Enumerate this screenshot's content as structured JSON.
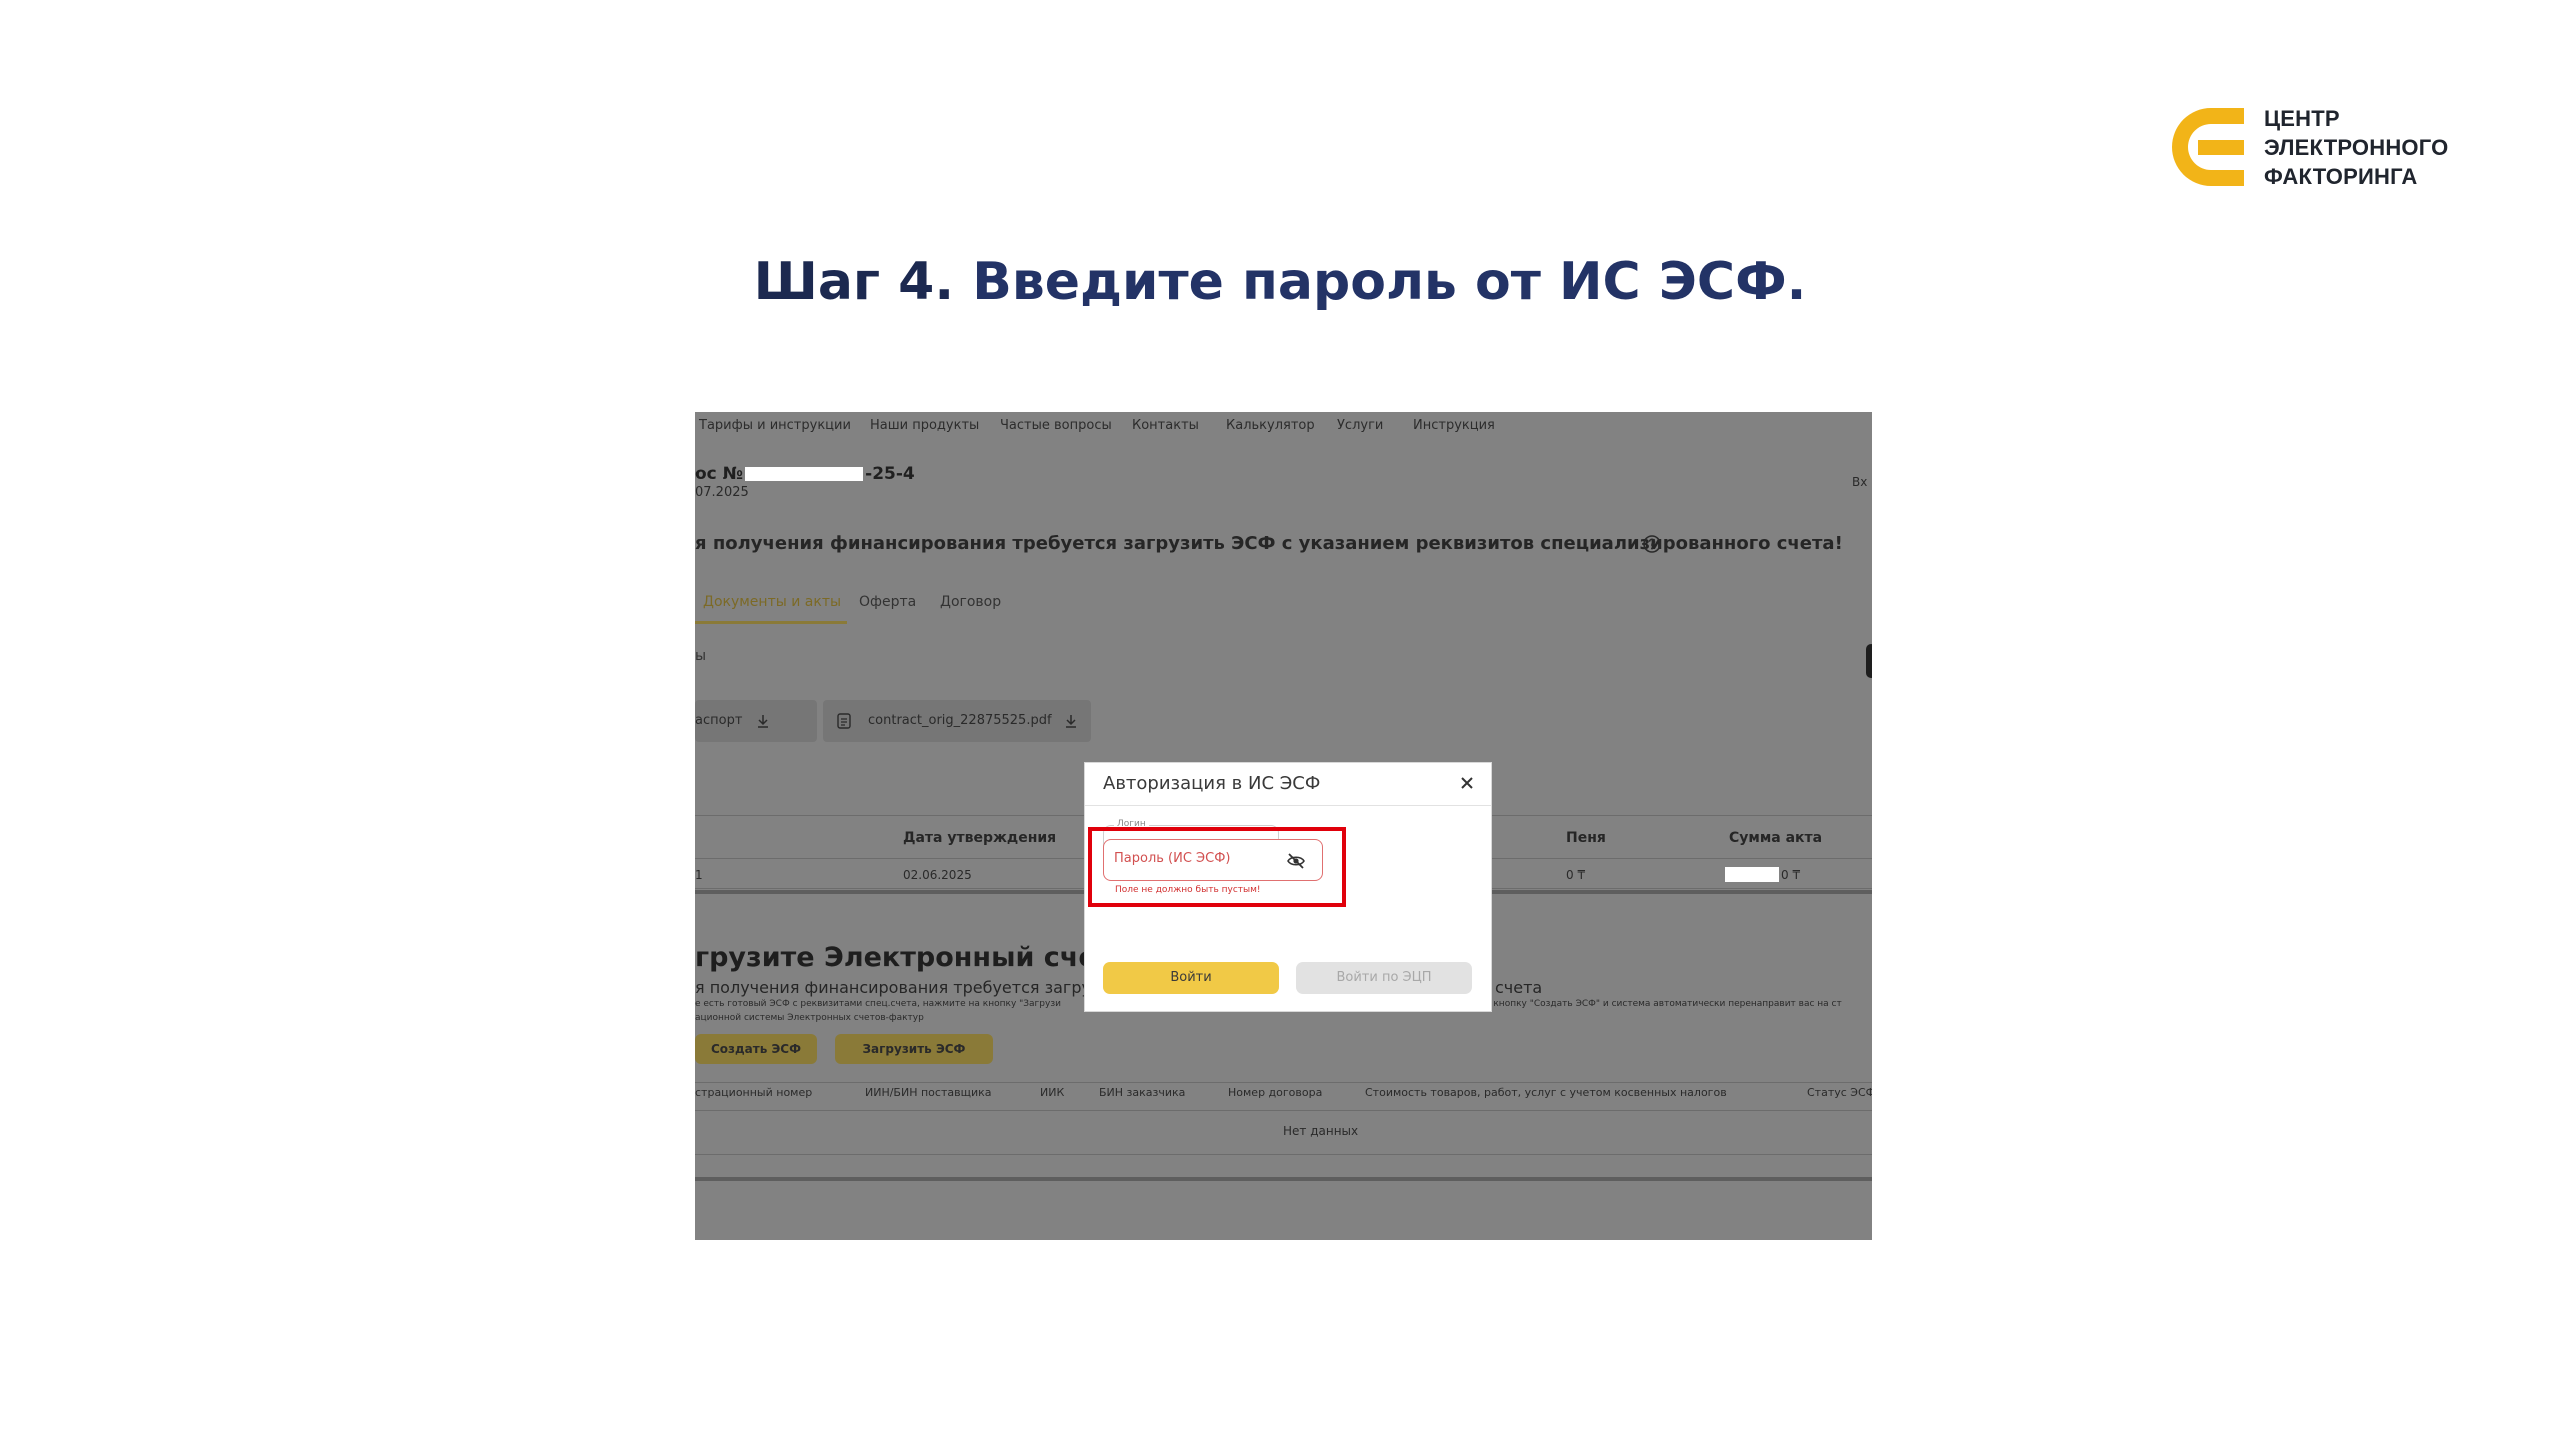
{
  "logo": {
    "lines": [
      "ЦЕНТР",
      "ЭЛЕКТРОННОГО",
      "ФАКТОРИНГА"
    ],
    "colors": {
      "accent": "#f2b418",
      "text": "#20252e"
    }
  },
  "slide_title": {
    "step": "Шаг 4.",
    "text": " Введите пароль от ИС ЭСФ."
  },
  "nav": [
    "Тарифы и инструкции",
    "Наши продукты",
    "Частые вопросы",
    "Контакты",
    "Калькулятор",
    "Услуги",
    "Инструкция"
  ],
  "deal": {
    "number_prefix": "ос №",
    "number_suffix": "-25-4",
    "date": "07.2025",
    "top_right": "Вх"
  },
  "notice": "я получения финансирования требуется загрузить ЭСФ с указанием реквизитов специализированного счета!",
  "tabs": [
    "Документы и акты",
    "Оферта",
    "Договор"
  ],
  "section_stub": "ы",
  "files": [
    {
      "label": "аспорт"
    },
    {
      "label": "contract_orig_22875525.pdf"
    }
  ],
  "acts_table": {
    "headers": [
      "Дата утверждения",
      "Пеня",
      "Сумма акта"
    ],
    "row": {
      "first": "1",
      "date": "02.06.2025",
      "penalty": "0 ₸",
      "amount_suffix": "0 ₸"
    }
  },
  "esf": {
    "heading": "грузите Электронный счет-факту",
    "subtext_left": "я получения финансирования требуется загрузить",
    "subtext_right": "счета",
    "small_left": "е есть готовый ЭСФ с реквизитами спец.счета, нажмите на кнопку \"Загрузи",
    "small_right": "а кнопку \"Создать ЭСФ\" и система автоматически перенаправит вас на ст",
    "small_line2": "ационной системы Электронных счетов-фактур",
    "create_btn": "Создать ЭСФ",
    "upload_btn": "Загрузить ЭСФ",
    "table_headers": [
      "страционный номер",
      "ИИН/БИН поставщика",
      "ИИК",
      "БИН заказчика",
      "Номер договора",
      "Стоимость товаров, работ, услуг с учетом косвенных налогов",
      "Статус ЭСФ"
    ],
    "empty": "Нет данных"
  },
  "modal": {
    "title": "Авторизация в ИС ЭСФ",
    "login_label": "Логин",
    "password_placeholder": "Пароль (ИС ЭСФ)",
    "error": "Поле не должно быть пустым!",
    "login_btn": "Войти",
    "ecp_btn": "Войти по ЭЦП"
  },
  "icons": [
    "logo-mark-icon",
    "help-icon",
    "download-icon",
    "file-icon",
    "close-icon",
    "eye-off-icon"
  ]
}
